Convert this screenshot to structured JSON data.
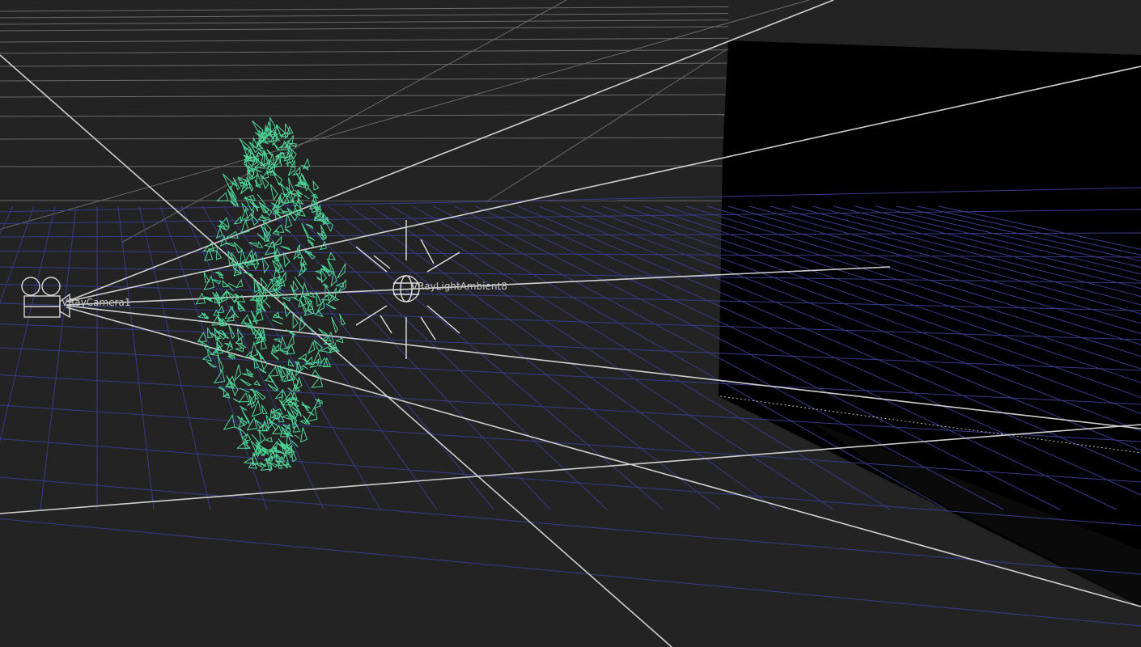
{
  "viewport": {
    "background_color": "#232323",
    "grid_color": "#6e6e6e",
    "floor_grid_color": "#3c3c8c",
    "selection_color": "#4fd699",
    "wall_color": "#000000"
  },
  "scene_objects": [
    {
      "label": "VRayCamera1",
      "icon": "movie-camera-icon"
    },
    {
      "label": "VRayLightAmbient8",
      "icon": "sun-light-icon"
    },
    {
      "label": "",
      "icon": "foliage-wireframe-mesh"
    }
  ]
}
